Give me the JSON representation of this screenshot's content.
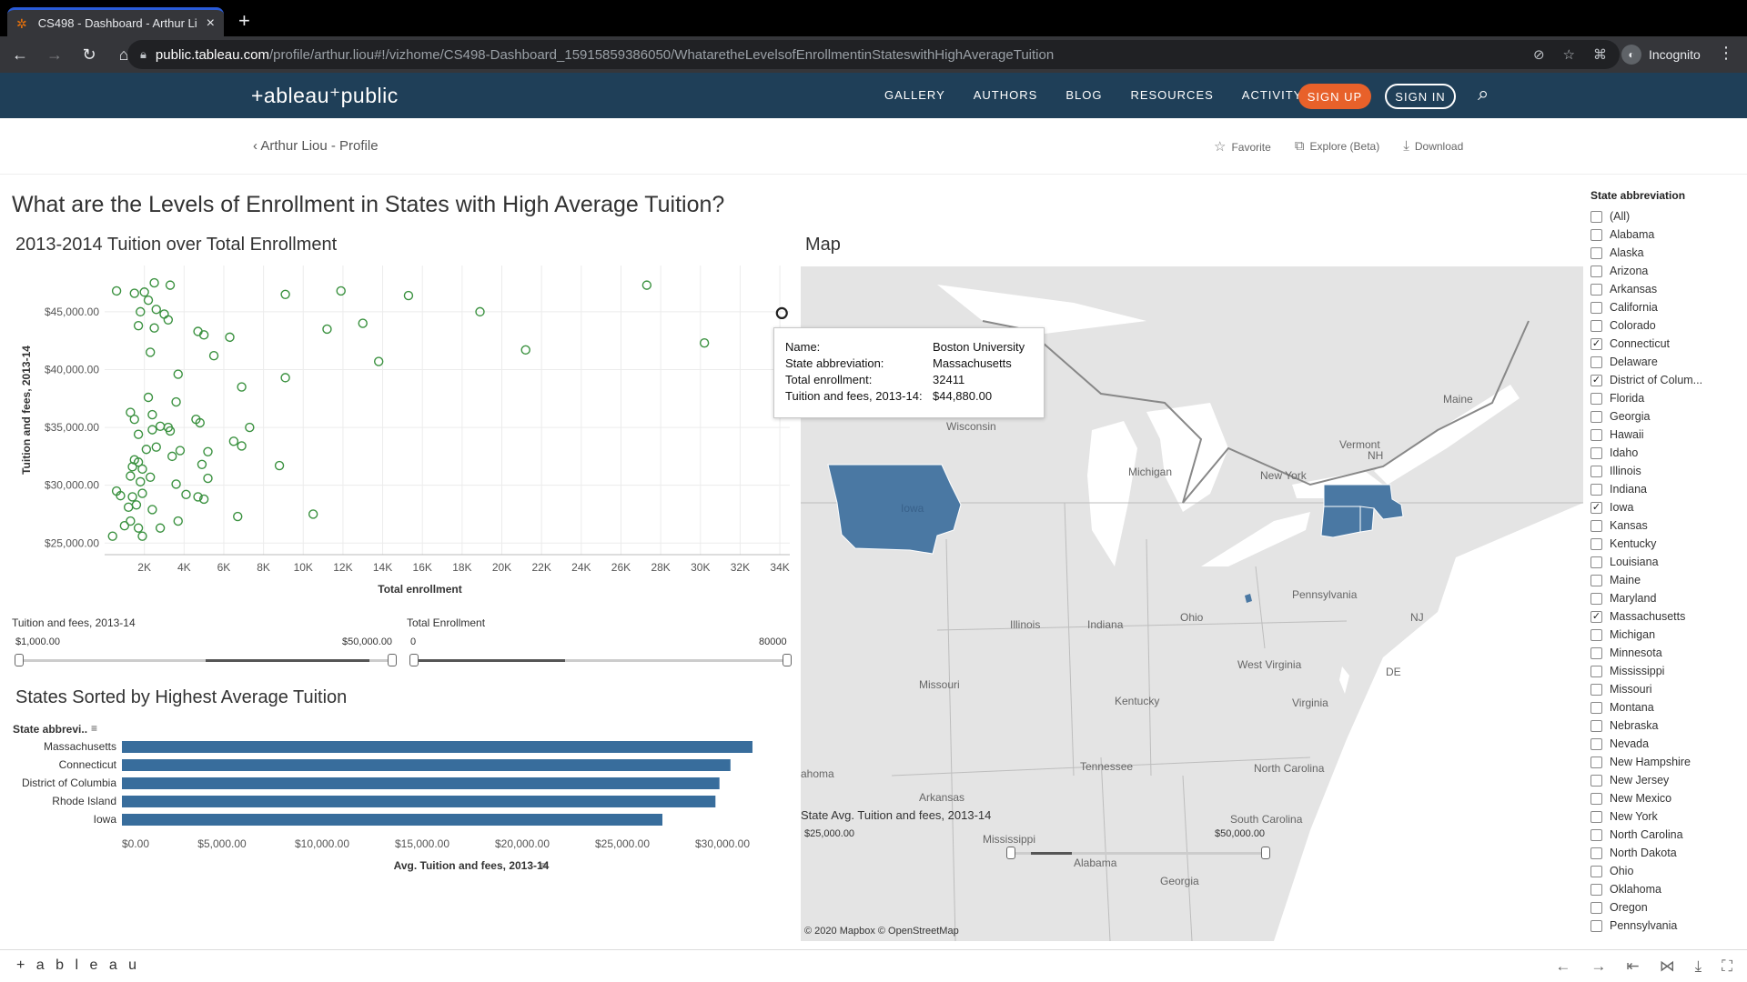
{
  "browser": {
    "tab_title": "CS498 - Dashboard - Arthur Li",
    "url_host": "public.tableau.com",
    "url_path": "/profile/arthur.liou#!/vizhome/CS498-Dashboard_15915859386050/WhataretheLevelsofEnrollmentinStateswithHighAverageTuition",
    "profile_label": "Incognito"
  },
  "header": {
    "logo": "+ableau⁺public",
    "nav": [
      "GALLERY",
      "AUTHORS",
      "BLOG",
      "RESOURCES",
      "ACTIVITY"
    ],
    "signup": "SIGN UP",
    "signin": "SIGN IN"
  },
  "subheader": {
    "back": "Arthur Liou - Profile",
    "favorite": "Favorite",
    "explore": "Explore (Beta)",
    "download": "Download"
  },
  "dashboard": {
    "title": "What are the Levels of Enrollment in States with High Average Tuition?",
    "scatter_title": "2013-2014 Tuition over Total Enrollment",
    "bar_title": "States Sorted by Highest Average Tuition",
    "map_title": "Map"
  },
  "filters": {
    "tuition_label": "Tuition and fees, 2013-14",
    "tuition_min": "$1,000.00",
    "tuition_max": "$50,000.00",
    "enroll_label": "Total Enrollment",
    "enroll_min": "0",
    "enroll_max": "80000",
    "state_avg_label": "State Avg. Tuition and fees, 2013-14",
    "state_avg_min": "$25,000.00",
    "state_avg_max": "$50,000.00"
  },
  "tooltip": {
    "rows": [
      {
        "k": "Name:",
        "v": "Boston University"
      },
      {
        "k": "State abbreviation:",
        "v": "Massachusetts"
      },
      {
        "k": "Total  enrollment:",
        "v": "32411"
      },
      {
        "k": "Tuition and fees, 2013-14:",
        "v": "$44,880.00"
      }
    ]
  },
  "map": {
    "labels": [
      "Wisconsin",
      "Michigan",
      "New York",
      "Vermont",
      "NH",
      "Maine",
      "Iowa",
      "Illinois",
      "Indiana",
      "Ohio",
      "Pennsylvania",
      "NJ",
      "DE",
      "West Virginia",
      "Virginia",
      "Kentucky",
      "Missouri",
      "Tennessee",
      "North Carolina",
      "Arkansas",
      "Mississippi",
      "Alabama",
      "Georgia",
      "South Carolina",
      "ahoma"
    ],
    "attribution": "© 2020 Mapbox © OpenStreetMap",
    "highlight_color": "#4a78a3"
  },
  "state_filter": {
    "title": "State abbreviation",
    "items": [
      {
        "label": "(All)",
        "checked": false
      },
      {
        "label": "Alabama",
        "checked": false
      },
      {
        "label": "Alaska",
        "checked": false
      },
      {
        "label": "Arizona",
        "checked": false
      },
      {
        "label": "Arkansas",
        "checked": false
      },
      {
        "label": "California",
        "checked": false
      },
      {
        "label": "Colorado",
        "checked": false
      },
      {
        "label": "Connecticut",
        "checked": true
      },
      {
        "label": "Delaware",
        "checked": false
      },
      {
        "label": "District of Colum...",
        "checked": true
      },
      {
        "label": "Florida",
        "checked": false
      },
      {
        "label": "Georgia",
        "checked": false
      },
      {
        "label": "Hawaii",
        "checked": false
      },
      {
        "label": "Idaho",
        "checked": false
      },
      {
        "label": "Illinois",
        "checked": false
      },
      {
        "label": "Indiana",
        "checked": false
      },
      {
        "label": "Iowa",
        "checked": true
      },
      {
        "label": "Kansas",
        "checked": false
      },
      {
        "label": "Kentucky",
        "checked": false
      },
      {
        "label": "Louisiana",
        "checked": false
      },
      {
        "label": "Maine",
        "checked": false
      },
      {
        "label": "Maryland",
        "checked": false
      },
      {
        "label": "Massachusetts",
        "checked": true
      },
      {
        "label": "Michigan",
        "checked": false
      },
      {
        "label": "Minnesota",
        "checked": false
      },
      {
        "label": "Mississippi",
        "checked": false
      },
      {
        "label": "Missouri",
        "checked": false
      },
      {
        "label": "Montana",
        "checked": false
      },
      {
        "label": "Nebraska",
        "checked": false
      },
      {
        "label": "Nevada",
        "checked": false
      },
      {
        "label": "New Hampshire",
        "checked": false
      },
      {
        "label": "New Jersey",
        "checked": false
      },
      {
        "label": "New Mexico",
        "checked": false
      },
      {
        "label": "New York",
        "checked": false
      },
      {
        "label": "North Carolina",
        "checked": false
      },
      {
        "label": "North Dakota",
        "checked": false
      },
      {
        "label": "Ohio",
        "checked": false
      },
      {
        "label": "Oklahoma",
        "checked": false
      },
      {
        "label": "Oregon",
        "checked": false
      },
      {
        "label": "Pennsylvania",
        "checked": false
      }
    ]
  },
  "footer": {
    "logo": "+ a b l e a u"
  },
  "chart_data": [
    {
      "type": "scatter",
      "xlabel": "Total  enrollment",
      "ylabel": "Tuition and fees, 2013-14",
      "xlim": [
        0,
        34500
      ],
      "ylim": [
        24000,
        49000
      ],
      "xticks": [
        "2K",
        "4K",
        "6K",
        "8K",
        "10K",
        "12K",
        "14K",
        "16K",
        "18K",
        "20K",
        "22K",
        "24K",
        "26K",
        "28K",
        "30K",
        "32K",
        "34K"
      ],
      "yticks": [
        "$25,000.00",
        "$30,000.00",
        "$35,000.00",
        "$40,000.00",
        "$45,000.00"
      ],
      "color": "#3a913f",
      "highlight_color": "#222222",
      "points": [
        [
          600,
          46800
        ],
        [
          1500,
          46600
        ],
        [
          2000,
          46700
        ],
        [
          2200,
          46000
        ],
        [
          2500,
          47500
        ],
        [
          3300,
          47300
        ],
        [
          1800,
          45000
        ],
        [
          2600,
          45200
        ],
        [
          3000,
          44800
        ],
        [
          3200,
          44300
        ],
        [
          1700,
          43800
        ],
        [
          2500,
          43600
        ],
        [
          4700,
          43300
        ],
        [
          5000,
          43000
        ],
        [
          5500,
          41200
        ],
        [
          6300,
          42800
        ],
        [
          2300,
          41500
        ],
        [
          3700,
          39600
        ],
        [
          1300,
          36300
        ],
        [
          1500,
          35700
        ],
        [
          2200,
          37600
        ],
        [
          3600,
          37200
        ],
        [
          2400,
          36100
        ],
        [
          6900,
          38500
        ],
        [
          2400,
          34800
        ],
        [
          2800,
          35100
        ],
        [
          3200,
          35000
        ],
        [
          3300,
          34700
        ],
        [
          4600,
          35700
        ],
        [
          4800,
          35400
        ],
        [
          7300,
          35000
        ],
        [
          1700,
          34400
        ],
        [
          2100,
          33100
        ],
        [
          2600,
          33300
        ],
        [
          3400,
          32500
        ],
        [
          3800,
          33000
        ],
        [
          6500,
          33800
        ],
        [
          6900,
          33400
        ],
        [
          1500,
          32200
        ],
        [
          1700,
          32000
        ],
        [
          1400,
          31600
        ],
        [
          1900,
          31400
        ],
        [
          4900,
          31800
        ],
        [
          5200,
          32900
        ],
        [
          1300,
          30800
        ],
        [
          1800,
          30300
        ],
        [
          2300,
          30700
        ],
        [
          3600,
          30100
        ],
        [
          5200,
          30600
        ],
        [
          600,
          29500
        ],
        [
          800,
          29100
        ],
        [
          1400,
          29000
        ],
        [
          1900,
          29300
        ],
        [
          4100,
          29200
        ],
        [
          4700,
          29000
        ],
        [
          5000,
          28800
        ],
        [
          1200,
          28100
        ],
        [
          1600,
          28300
        ],
        [
          2400,
          27900
        ],
        [
          1300,
          26900
        ],
        [
          1000,
          26500
        ],
        [
          1700,
          26300
        ],
        [
          2800,
          26300
        ],
        [
          3700,
          26900
        ],
        [
          1900,
          25600
        ],
        [
          400,
          25600
        ],
        [
          6700,
          27300
        ],
        [
          9100,
          46500
        ],
        [
          11900,
          46800
        ],
        [
          15300,
          46400
        ],
        [
          11200,
          43500
        ],
        [
          13000,
          44000
        ],
        [
          13800,
          40700
        ],
        [
          9100,
          39300
        ],
        [
          8800,
          31700
        ],
        [
          10500,
          27500
        ],
        [
          18900,
          45000
        ],
        [
          21200,
          41700
        ],
        [
          27300,
          47300
        ],
        [
          30200,
          42300
        ],
        [
          34100,
          44880
        ]
      ],
      "highlight_index": 80
    },
    {
      "type": "bar",
      "orientation": "horizontal",
      "ylabel": "State abbrevi..",
      "xlabel": "Avg. Tuition and fees, 2013-14",
      "categories": [
        "Massachusetts",
        "Connecticut",
        "District of Columbia",
        "Rhode Island",
        "Iowa"
      ],
      "values": [
        31500,
        30400,
        29850,
        29650,
        27000
      ],
      "xlim": [
        0,
        33000
      ],
      "xticks": [
        "$0.00",
        "$5,000.00",
        "$10,000.00",
        "$15,000.00",
        "$20,000.00",
        "$25,000.00",
        "$30,000.00"
      ],
      "color": "#386d9c"
    }
  ]
}
